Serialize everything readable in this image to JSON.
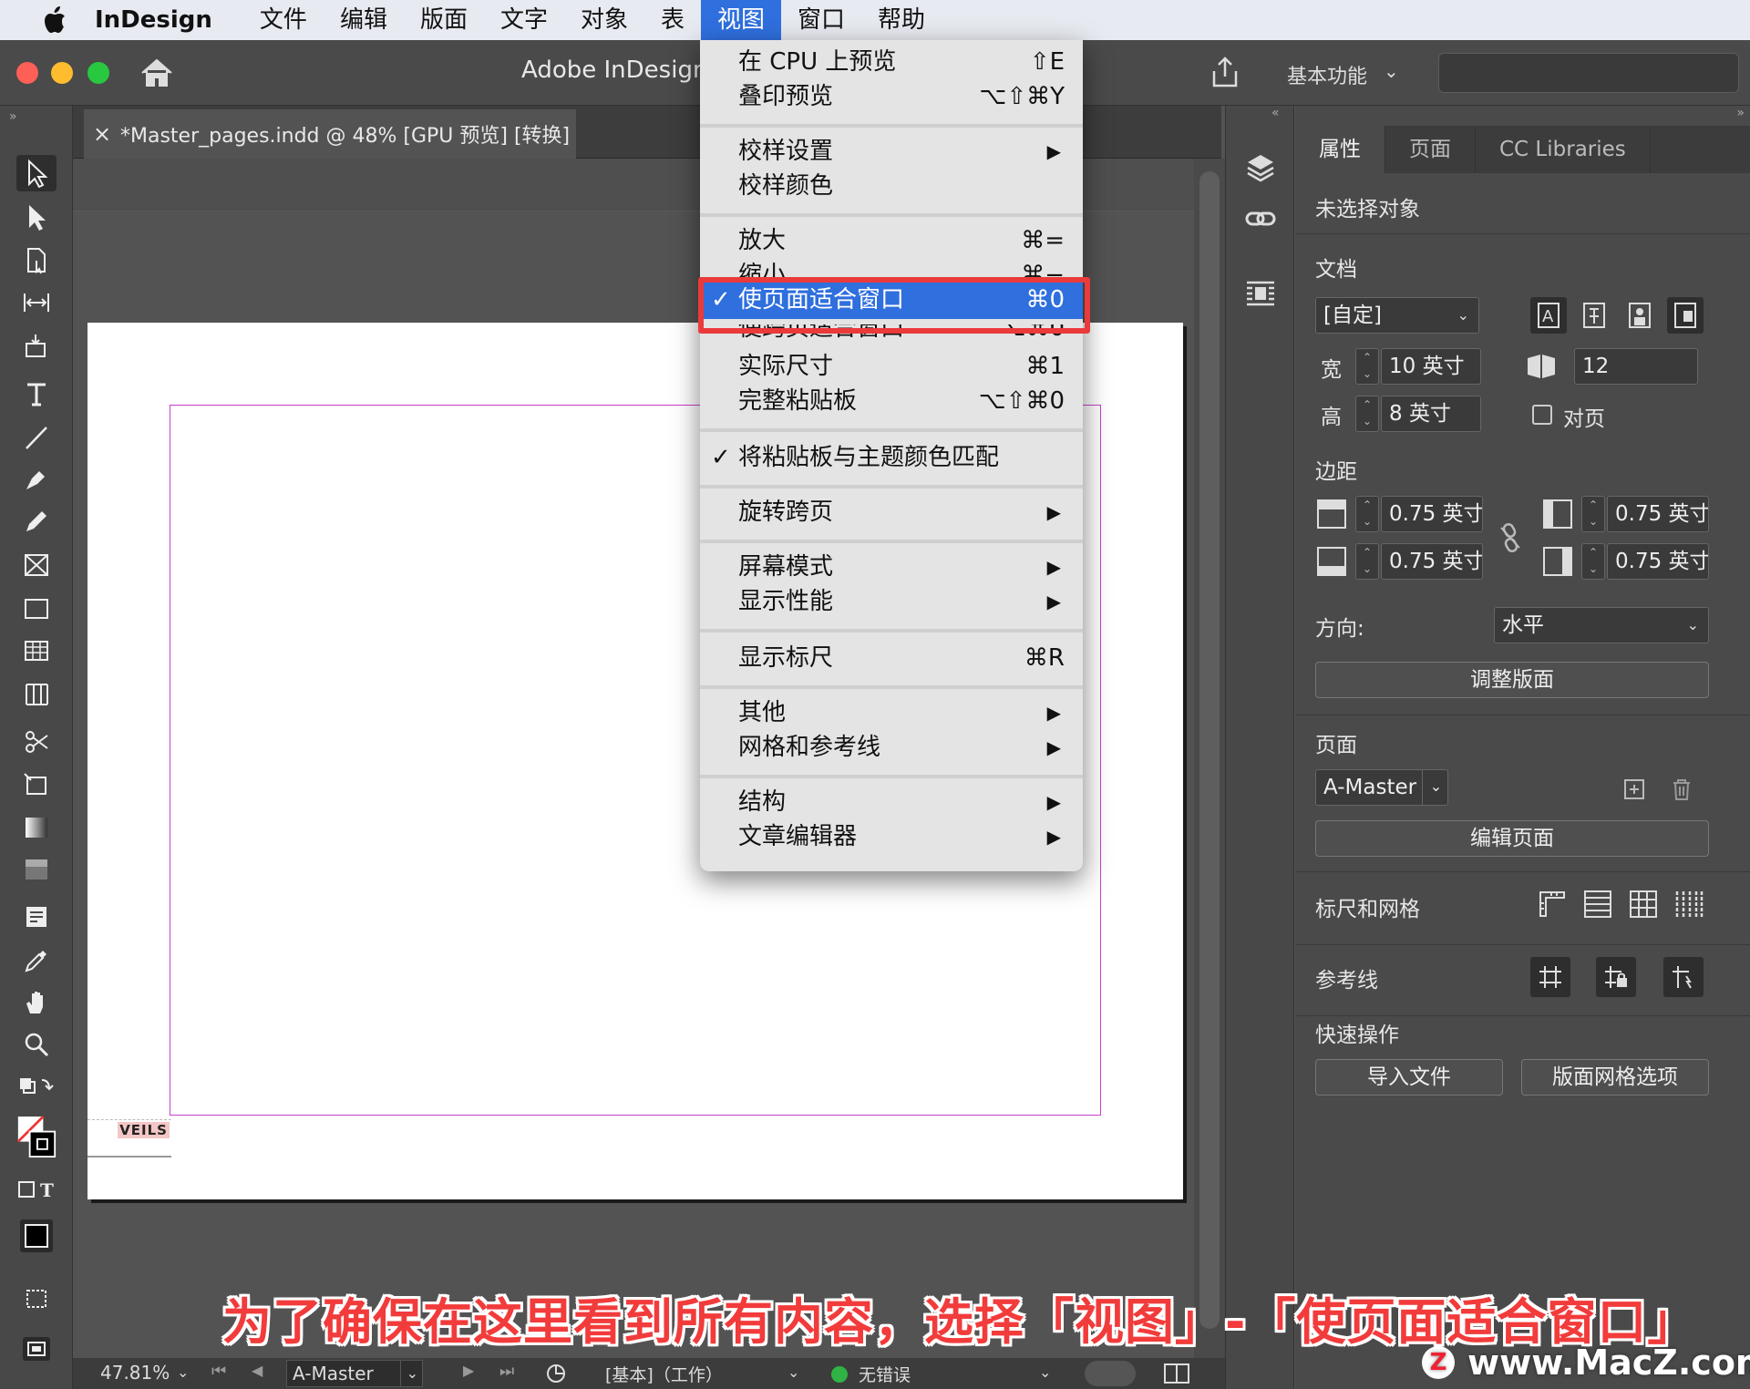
{
  "menubar": {
    "app": "InDesign",
    "items": [
      "文件",
      "编辑",
      "版面",
      "文字",
      "对象",
      "表",
      "视图",
      "窗口",
      "帮助"
    ],
    "active_index": 6
  },
  "titlebar": {
    "title": "Adobe InDesign",
    "workspace": "基本功能",
    "search_placeholder": ""
  },
  "document_tab": {
    "close": "×",
    "label": "*Master_pages.indd @ 48% [GPU 预览] [转换]"
  },
  "canvas": {
    "slug_text": "VEILS"
  },
  "view_menu": {
    "items": [
      {
        "label": "在 CPU 上预览",
        "shortcut": "⇧E"
      },
      {
        "label": "叠印预览",
        "shortcut": "⌥⇧⌘Y"
      },
      {
        "label": "校样设置",
        "arrow": "▶"
      },
      {
        "label": "校样颜色"
      },
      {
        "label": "放大",
        "shortcut": "⌘="
      },
      {
        "label": "缩小",
        "shortcut": "⌘−"
      },
      {
        "label": "使页面适合窗口",
        "shortcut": "⌘0",
        "check": "✓"
      },
      {
        "label": "使跨页适合窗口",
        "shortcut": "⌥⌘0"
      },
      {
        "label": "实际尺寸",
        "shortcut": "⌘1"
      },
      {
        "label": "完整粘贴板",
        "shortcut": "⌥⇧⌘0"
      },
      {
        "label": "将粘贴板与主题颜色匹配",
        "check": "✓"
      },
      {
        "label": "旋转跨页",
        "arrow": "▶"
      },
      {
        "label": "屏幕模式",
        "arrow": "▶"
      },
      {
        "label": "显示性能",
        "arrow": "▶"
      },
      {
        "label": "显示标尺",
        "shortcut": "⌘R"
      },
      {
        "label": "其他",
        "arrow": "▶"
      },
      {
        "label": "网格和参考线",
        "arrow": "▶"
      },
      {
        "label": "结构",
        "arrow": "▶"
      },
      {
        "label": "文章编辑器",
        "arrow": "▶"
      }
    ]
  },
  "panel": {
    "tabs": [
      "属性",
      "页面",
      "CC Libraries"
    ],
    "no_selection": "未选择对象",
    "document_heading": "文档",
    "preset": "[自定]",
    "width_label": "宽",
    "width_value": "10 英寸",
    "height_label": "高",
    "height_value": "8 英寸",
    "pages_value": "12",
    "facing_pages": "对页",
    "margins_heading": "边距",
    "margin_top": "0.75 英寸",
    "margin_bottom": "0.75 英寸",
    "margin_left": "0.75 英寸",
    "margin_right": "0.75 英寸",
    "orientation_label": "方向:",
    "orientation_value": "水平",
    "adjust_layout": "调整版面",
    "page_heading": "页面",
    "master_value": "A-Master",
    "edit_page": "编辑页面",
    "rulers_grids": "标尺和网格",
    "guides": "参考线",
    "quick_actions": "快速操作",
    "import_file": "导入文件",
    "layout_grid_options": "版面网格选项"
  },
  "statusbar": {
    "zoom": "47.81%",
    "page": "A-Master",
    "profile": "[基本]（工作）",
    "errors": "无错误"
  },
  "caption": "为了确保在这里看到所有内容，选择「视图」-「使页面适合窗口」",
  "watermark": "www.MacZ.com",
  "colors": {
    "menu_highlight": "#2f6fde",
    "callout_red": "#ea3a3a",
    "margin_guide": "#c840c8"
  }
}
